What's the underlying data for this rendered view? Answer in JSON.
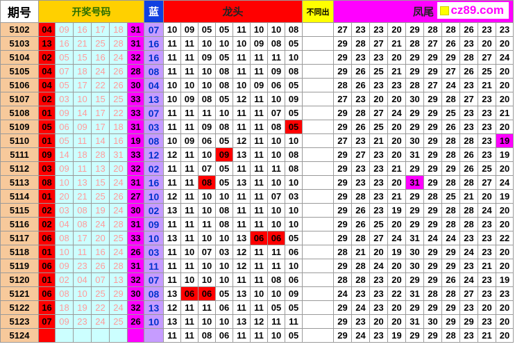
{
  "header": {
    "qihao": "期号",
    "kaijiang": "开奖号码",
    "lan": "蓝",
    "longtou": "龙头",
    "butongchu": "不同出",
    "fengwei": "凤尾",
    "logo": "cz89.com"
  },
  "colors": {
    "red_ball": "#ff0000",
    "sixth_ball": "#ff00ff",
    "blue_ball": "#c69cff",
    "period": "#f7c99b",
    "header_yellow": "#ffd000",
    "header_magenta": "#ff00ff"
  },
  "rows": [
    {
      "q": "5102",
      "r": [
        "04",
        "09",
        "16",
        "17",
        "18",
        "31"
      ],
      "b": "07",
      "L": [
        "10",
        "09",
        "05",
        "05",
        "11",
        "10",
        "10",
        "08"
      ],
      "Lh": [],
      "F": [
        "27",
        "23",
        "23",
        "20",
        "29",
        "28",
        "28",
        "26",
        "23",
        "23"
      ],
      "Fh": []
    },
    {
      "q": "5103",
      "r": [
        "13",
        "16",
        "21",
        "25",
        "28",
        "31"
      ],
      "b": "16",
      "L": [
        "11",
        "11",
        "10",
        "10",
        "10",
        "09",
        "08",
        "05"
      ],
      "Lh": [],
      "F": [
        "29",
        "28",
        "27",
        "21",
        "28",
        "27",
        "26",
        "23",
        "20",
        "20"
      ],
      "Fh": []
    },
    {
      "q": "5104",
      "r": [
        "02",
        "05",
        "15",
        "16",
        "24",
        "32"
      ],
      "b": "16",
      "L": [
        "11",
        "11",
        "09",
        "05",
        "11",
        "11",
        "11",
        "10"
      ],
      "Lh": [],
      "F": [
        "29",
        "23",
        "23",
        "20",
        "29",
        "29",
        "29",
        "28",
        "27",
        "24"
      ],
      "Fh": []
    },
    {
      "q": "5105",
      "r": [
        "04",
        "07",
        "18",
        "24",
        "26",
        "28"
      ],
      "b": "08",
      "L": [
        "11",
        "11",
        "10",
        "08",
        "11",
        "11",
        "09",
        "08"
      ],
      "Lh": [],
      "F": [
        "29",
        "26",
        "25",
        "21",
        "29",
        "29",
        "27",
        "26",
        "25",
        "20"
      ],
      "Fh": []
    },
    {
      "q": "5106",
      "r": [
        "04",
        "05",
        "17",
        "22",
        "26",
        "30"
      ],
      "b": "04",
      "L": [
        "10",
        "10",
        "10",
        "08",
        "10",
        "09",
        "06",
        "05"
      ],
      "Lh": [],
      "F": [
        "28",
        "26",
        "23",
        "23",
        "28",
        "27",
        "24",
        "23",
        "21",
        "20"
      ],
      "Fh": []
    },
    {
      "q": "5107",
      "r": [
        "02",
        "03",
        "10",
        "15",
        "25",
        "33"
      ],
      "b": "13",
      "L": [
        "10",
        "09",
        "08",
        "05",
        "12",
        "11",
        "10",
        "09"
      ],
      "Lh": [],
      "F": [
        "27",
        "23",
        "20",
        "20",
        "30",
        "29",
        "28",
        "27",
        "23",
        "20"
      ],
      "Fh": []
    },
    {
      "q": "5108",
      "r": [
        "01",
        "09",
        "14",
        "17",
        "22",
        "33"
      ],
      "b": "07",
      "L": [
        "11",
        "11",
        "11",
        "10",
        "11",
        "11",
        "07",
        "05"
      ],
      "Lh": [],
      "F": [
        "29",
        "28",
        "27",
        "24",
        "29",
        "29",
        "25",
        "23",
        "23",
        "21"
      ],
      "Fh": []
    },
    {
      "q": "5109",
      "r": [
        "05",
        "06",
        "09",
        "17",
        "18",
        "31"
      ],
      "b": "03",
      "L": [
        "11",
        "11",
        "09",
        "08",
        "11",
        "11",
        "08",
        "05"
      ],
      "Lh": [
        7
      ],
      "F": [
        "29",
        "26",
        "25",
        "20",
        "29",
        "29",
        "26",
        "23",
        "23",
        "20"
      ],
      "Fh": []
    },
    {
      "q": "5110",
      "r": [
        "01",
        "05",
        "11",
        "14",
        "16",
        "19"
      ],
      "b": "08",
      "L": [
        "10",
        "09",
        "06",
        "05",
        "12",
        "11",
        "10",
        "10"
      ],
      "Lh": [],
      "F": [
        "27",
        "23",
        "21",
        "20",
        "30",
        "29",
        "28",
        "28",
        "23",
        "19"
      ],
      "Fh": [
        9
      ]
    },
    {
      "q": "5111",
      "r": [
        "09",
        "14",
        "18",
        "28",
        "31",
        "33"
      ],
      "b": "12",
      "L": [
        "12",
        "11",
        "10",
        "09",
        "13",
        "11",
        "10",
        "08"
      ],
      "Lh": [
        3
      ],
      "F": [
        "29",
        "27",
        "23",
        "20",
        "31",
        "29",
        "28",
        "26",
        "23",
        "19"
      ],
      "Fh": []
    },
    {
      "q": "5112",
      "r": [
        "03",
        "09",
        "11",
        "13",
        "20",
        "32"
      ],
      "b": "02",
      "L": [
        "11",
        "11",
        "07",
        "05",
        "11",
        "11",
        "11",
        "08"
      ],
      "Lh": [],
      "F": [
        "29",
        "23",
        "23",
        "21",
        "29",
        "29",
        "29",
        "26",
        "25",
        "20"
      ],
      "Fh": []
    },
    {
      "q": "5113",
      "r": [
        "08",
        "10",
        "13",
        "15",
        "24",
        "31"
      ],
      "b": "16",
      "L": [
        "11",
        "11",
        "08",
        "05",
        "13",
        "11",
        "10",
        "10"
      ],
      "Lh": [
        2
      ],
      "F": [
        "29",
        "23",
        "23",
        "20",
        "31",
        "29",
        "28",
        "28",
        "27",
        "24"
      ],
      "Fh": [
        4
      ]
    },
    {
      "q": "5114",
      "r": [
        "01",
        "20",
        "21",
        "25",
        "26",
        "27"
      ],
      "b": "10",
      "L": [
        "12",
        "11",
        "10",
        "10",
        "11",
        "11",
        "07",
        "03"
      ],
      "Lh": [],
      "F": [
        "29",
        "28",
        "23",
        "21",
        "29",
        "28",
        "25",
        "21",
        "20",
        "19"
      ],
      "Fh": []
    },
    {
      "q": "5115",
      "r": [
        "02",
        "03",
        "08",
        "19",
        "24",
        "30"
      ],
      "b": "02",
      "L": [
        "13",
        "11",
        "10",
        "08",
        "11",
        "11",
        "10",
        "10"
      ],
      "Lh": [],
      "F": [
        "29",
        "26",
        "23",
        "19",
        "29",
        "29",
        "28",
        "28",
        "24",
        "20"
      ],
      "Fh": []
    },
    {
      "q": "5116",
      "r": [
        "02",
        "04",
        "08",
        "24",
        "28",
        "31"
      ],
      "b": "09",
      "L": [
        "11",
        "11",
        "11",
        "08",
        "11",
        "11",
        "10",
        "10"
      ],
      "Lh": [],
      "F": [
        "29",
        "26",
        "25",
        "20",
        "29",
        "29",
        "28",
        "28",
        "23",
        "20"
      ],
      "Fh": []
    },
    {
      "q": "5117",
      "r": [
        "06",
        "08",
        "17",
        "20",
        "25",
        "33"
      ],
      "b": "10",
      "L": [
        "13",
        "11",
        "10",
        "10",
        "13",
        "06",
        "06",
        "05"
      ],
      "Lh": [
        5,
        6
      ],
      "F": [
        "29",
        "28",
        "27",
        "24",
        "31",
        "24",
        "24",
        "23",
        "23",
        "22"
      ],
      "Fh": []
    },
    {
      "q": "5118",
      "r": [
        "01",
        "10",
        "11",
        "16",
        "24",
        "26"
      ],
      "b": "03",
      "L": [
        "11",
        "10",
        "07",
        "03",
        "12",
        "11",
        "11",
        "06"
      ],
      "Lh": [],
      "F": [
        "28",
        "21",
        "20",
        "19",
        "30",
        "29",
        "29",
        "24",
        "23",
        "20"
      ],
      "Fh": []
    },
    {
      "q": "5119",
      "r": [
        "06",
        "09",
        "23",
        "26",
        "28",
        "31"
      ],
      "b": "11",
      "L": [
        "11",
        "11",
        "10",
        "10",
        "12",
        "11",
        "11",
        "10"
      ],
      "Lh": [],
      "F": [
        "29",
        "28",
        "24",
        "20",
        "30",
        "29",
        "29",
        "23",
        "21",
        "20"
      ],
      "Fh": []
    },
    {
      "q": "5120",
      "r": [
        "01",
        "02",
        "04",
        "07",
        "13",
        "32"
      ],
      "b": "07",
      "L": [
        "11",
        "10",
        "10",
        "10",
        "11",
        "11",
        "08",
        "06"
      ],
      "Lh": [],
      "F": [
        "28",
        "28",
        "23",
        "20",
        "29",
        "29",
        "26",
        "24",
        "23",
        "19"
      ],
      "Fh": []
    },
    {
      "q": "5121",
      "r": [
        "06",
        "08",
        "10",
        "25",
        "29",
        "30"
      ],
      "b": "08",
      "L": [
        "13",
        "06",
        "06",
        "05",
        "13",
        "10",
        "10",
        "09"
      ],
      "Lh": [
        1,
        2
      ],
      "F": [
        "24",
        "23",
        "23",
        "22",
        "31",
        "28",
        "28",
        "27",
        "23",
        "23"
      ],
      "Fh": []
    },
    {
      "q": "5122",
      "r": [
        "16",
        "18",
        "19",
        "22",
        "24",
        "32"
      ],
      "b": "13",
      "L": [
        "12",
        "11",
        "11",
        "06",
        "11",
        "11",
        "05",
        "05"
      ],
      "Lh": [],
      "F": [
        "29",
        "24",
        "23",
        "20",
        "29",
        "29",
        "29",
        "23",
        "20",
        "20"
      ],
      "Fh": []
    },
    {
      "q": "5123",
      "r": [
        "07",
        "09",
        "23",
        "24",
        "25",
        "26"
      ],
      "b": "10",
      "L": [
        "13",
        "11",
        "10",
        "10",
        "13",
        "12",
        "11",
        "11"
      ],
      "Lh": [],
      "F": [
        "29",
        "23",
        "20",
        "20",
        "31",
        "30",
        "29",
        "29",
        "23",
        "20"
      ],
      "Fh": []
    },
    {
      "q": "5124",
      "r": [
        "",
        "",
        "",
        "",
        "",
        ""
      ],
      "b": "",
      "L": [
        "11",
        "11",
        "08",
        "06",
        "11",
        "11",
        "10",
        "05"
      ],
      "Lh": [],
      "F": [
        "29",
        "24",
        "23",
        "19",
        "29",
        "29",
        "28",
        "23",
        "21",
        "20"
      ],
      "Fh": []
    }
  ]
}
